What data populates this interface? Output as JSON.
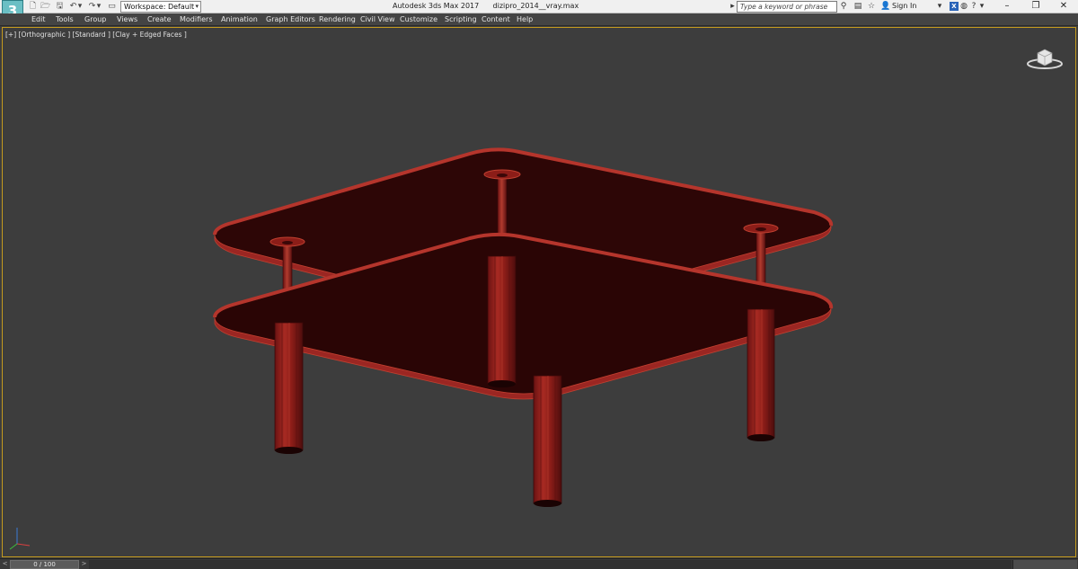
{
  "titlebar": {
    "logo_text": "3",
    "workspace_label": "Workspace: Default",
    "app_title": "Autodesk 3ds Max 2017",
    "file_name": "dizipro_2014__vray.max",
    "search_placeholder": "Type a keyword or phrase",
    "signin_label": "Sign In"
  },
  "menu": {
    "items": [
      "Edit",
      "Tools",
      "Group",
      "Views",
      "Create",
      "Modifiers",
      "Animation",
      "Graph Editors",
      "Rendering",
      "Civil View",
      "Customize",
      "Scripting",
      "Content",
      "Help"
    ]
  },
  "viewport": {
    "label": "[+] [Orthographic ] [Standard ] [Clay + Edged Faces ]",
    "viewport_frame_color": "#c49a1e",
    "model_color": "#8b1a1a",
    "model_edge_color": "#c04030"
  },
  "timeline": {
    "frame_readout": "0 / 100",
    "current_frame": 0,
    "total_frames": 100
  },
  "icons": {
    "new": "new-file-icon",
    "open": "open-folder-icon",
    "save": "save-icon",
    "undo": "undo-icon",
    "redo": "redo-icon",
    "project": "project-folder-icon",
    "search": "binoculars-icon",
    "star": "star-icon",
    "user": "user-icon",
    "help": "help-icon"
  }
}
